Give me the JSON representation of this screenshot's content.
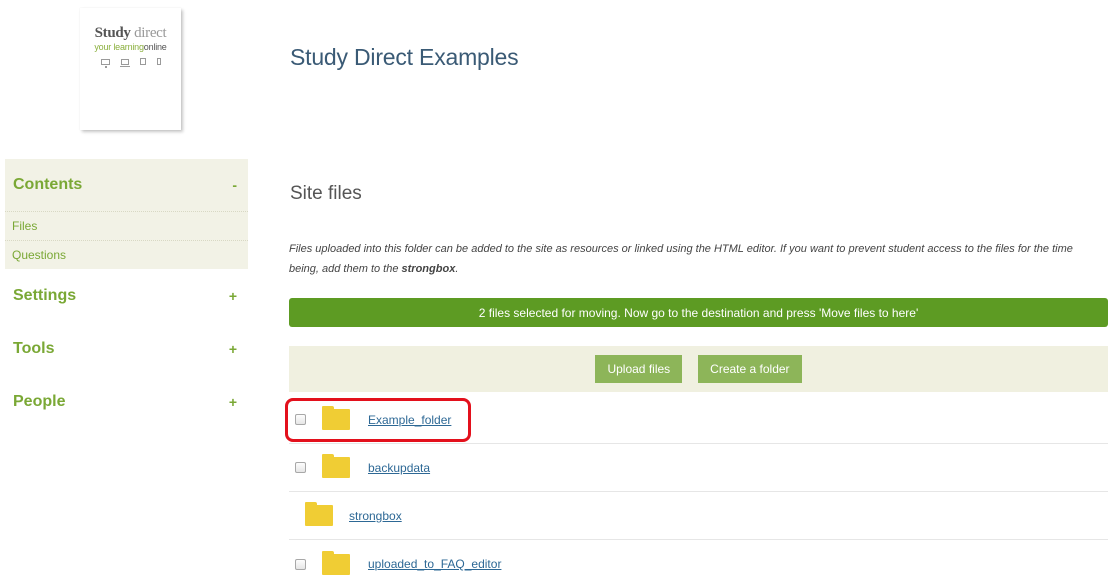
{
  "logo": {
    "title_part1": "Study",
    "title_part2": "direct",
    "tagline_part1": "your learning",
    "tagline_part2": "online"
  },
  "site_title": "Study Direct Examples",
  "sidebar": {
    "contents": {
      "title": "Contents",
      "toggle": "-",
      "items": [
        {
          "label": "Files"
        },
        {
          "label": "Questions"
        }
      ]
    },
    "sections": [
      {
        "title": "Settings",
        "toggle": "+"
      },
      {
        "title": "Tools",
        "toggle": "+"
      },
      {
        "title": "People",
        "toggle": "+"
      }
    ]
  },
  "main": {
    "section_title": "Site files",
    "intro_text": "Files uploaded into this folder can be added to the site as resources or linked using the HTML editor. If you want to prevent student access to the files for the time being, add them to the",
    "intro_bold": "strongbox",
    "intro_end": ".",
    "alert": "2 files selected for moving. Now go to the destination and press 'Move files to here'",
    "buttons": {
      "upload": "Upload files",
      "create_folder": "Create a folder"
    },
    "files": [
      {
        "name": "Example_folder",
        "has_checkbox": true
      },
      {
        "name": "backupdata",
        "has_checkbox": true
      },
      {
        "name": "strongbox",
        "has_checkbox": false
      },
      {
        "name": "uploaded_to_FAQ_editor",
        "has_checkbox": true
      }
    ]
  },
  "colors": {
    "accent_green": "#7aa835",
    "alert_green": "#5d9b23",
    "button_green": "#8db559",
    "folder_yellow": "#f0cd34",
    "link_blue": "#2d6895",
    "highlight_red": "#e3101c"
  },
  "icons": [
    "monitor-icon",
    "laptop-icon",
    "tablet-icon",
    "phone-icon",
    "folder-icon"
  ]
}
